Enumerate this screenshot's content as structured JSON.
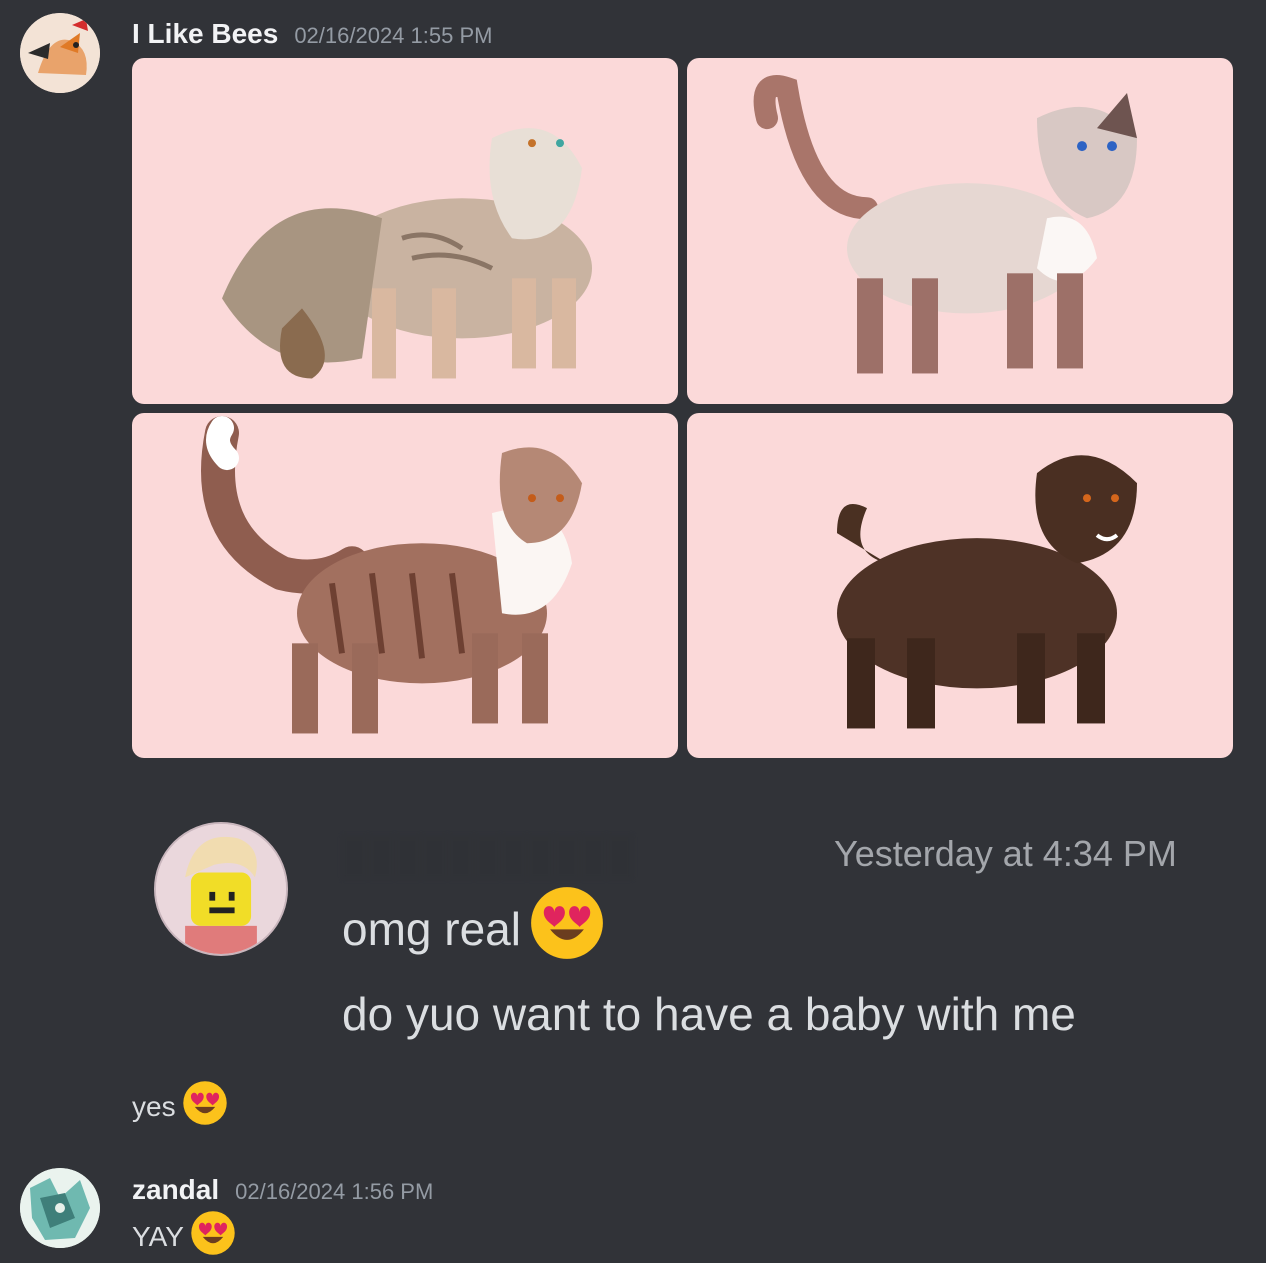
{
  "messages": [
    {
      "username": "I Like Bees",
      "timestamp": "02/16/2024 1:55 PM",
      "attachments": [
        {
          "alt": "cat-ref-1"
        },
        {
          "alt": "cat-ref-2"
        },
        {
          "alt": "cat-ref-3"
        },
        {
          "alt": "cat-ref-4"
        }
      ]
    },
    {
      "quoted": {
        "timestamp": "Yesterday at 4:34 PM",
        "lines": [
          "omg real",
          "do yuo want to have a baby with me"
        ]
      }
    },
    {
      "text": "yes"
    },
    {
      "username": "zandal",
      "timestamp": "02/16/2024 1:56 PM",
      "text": "YAY"
    }
  ],
  "emoji": {
    "heart_eyes": "heart-eyes-icon"
  },
  "colors": {
    "background": "#313338",
    "username": "#f2f3f5",
    "timestamp": "#949ba4",
    "text": "#dbdee1",
    "tile_bg": "#fbd9d9"
  }
}
